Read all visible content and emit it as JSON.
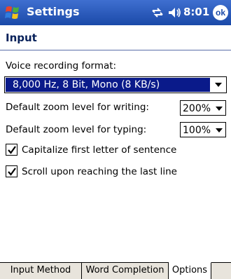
{
  "titlebar": {
    "app_title": "Settings",
    "clock": "8:01",
    "ok_label": "ok",
    "colors": {
      "bar": "#1a49a8"
    }
  },
  "page": {
    "title": "Input"
  },
  "voice": {
    "label": "Voice recording format:",
    "value": "8,000 Hz, 8 Bit, Mono (8 KB/s)"
  },
  "zoom_writing": {
    "label": "Default zoom level for writing:",
    "value": "200%"
  },
  "zoom_typing": {
    "label": "Default zoom level for typing:",
    "value": "100%"
  },
  "options": {
    "capitalize": {
      "label": "Capitalize first letter of sentence",
      "checked": true
    },
    "scroll": {
      "label": "Scroll upon reaching the last line",
      "checked": true
    }
  },
  "tabs": [
    {
      "label": "Input Method",
      "active": false
    },
    {
      "label": "Word Completion",
      "active": false
    },
    {
      "label": "Options",
      "active": true
    }
  ],
  "icons": [
    "windows-start-icon",
    "connectivity-icon",
    "volume-icon",
    "checkmark-icon",
    "dropdown-arrow-icon"
  ]
}
